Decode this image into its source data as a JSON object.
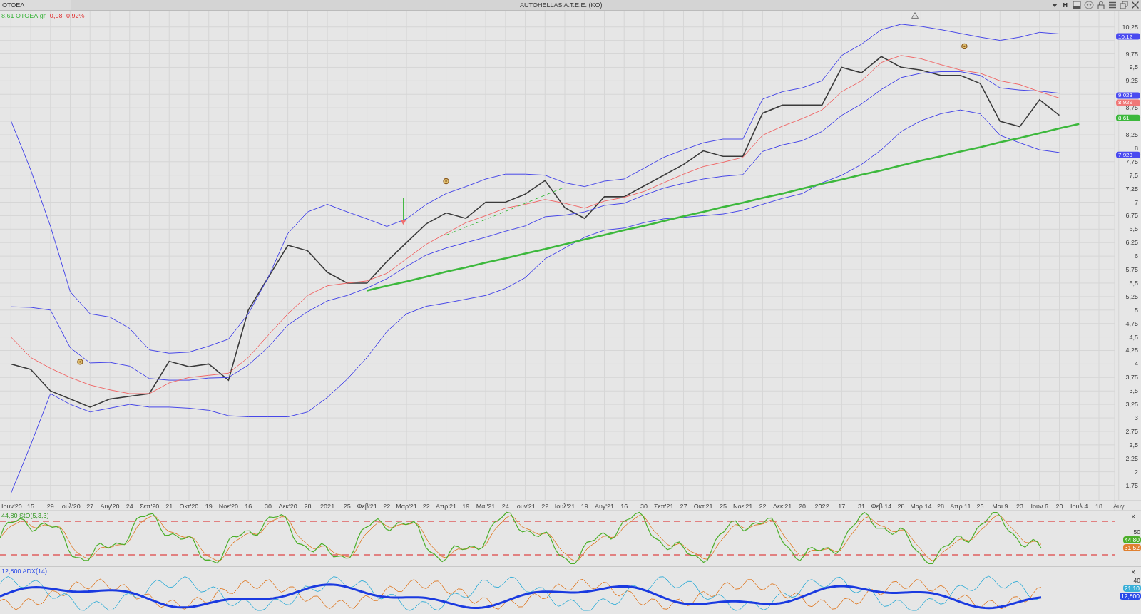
{
  "window": {
    "symbol_tab": "ΟΤΟΕΛ",
    "title": "AUTOHELLAS A.T.E.E. (KO)",
    "toolbar_letter": "H"
  },
  "quote": {
    "last": "8,61 ΟΤΟΕΛ.gr",
    "change": "-0,08 -0,92%"
  },
  "price_chart": {
    "chart_data": {
      "type": "line",
      "grid": true,
      "categories": [
        "Ιουν'20",
        "15",
        "29",
        "Ιουλ'20",
        "27",
        "Αυγ'20",
        "24",
        "Σεπ'20",
        "21",
        "Οκτ'20",
        "19",
        "Νοε'20",
        "16",
        "30",
        "Δεκ'20",
        "28",
        "2021",
        "25",
        "Φεβ'21",
        "22",
        "Μαρ'21",
        "22",
        "Απρ'21",
        "19",
        "Μαι'21",
        "24",
        "Ιουν'21",
        "22",
        "Ιουλ'21",
        "19",
        "Αυγ'21",
        "16",
        "30",
        "Σεπ'21",
        "27",
        "Οκτ'21",
        "25",
        "Νοε'21",
        "22",
        "Δεκ'21",
        "20",
        "2022",
        "17",
        "31",
        "Φεβ 14",
        "28",
        "Μαρ 14",
        "28",
        "Απρ 11",
        "26",
        "Μαι 9",
        "23",
        "Ιουν 6",
        "20",
        "Ιουλ 4",
        "18",
        "Αυγ"
      ],
      "ylim": [
        1.48,
        10.55
      ],
      "yticks": [
        {
          "value": 10.25,
          "label": "10,25"
        },
        {
          "value": 9.75,
          "label": "9,75"
        },
        {
          "value": 9.5,
          "label": "9,5"
        },
        {
          "value": 9.25,
          "label": "9,25"
        },
        {
          "value": 8.75,
          "label": "8,75"
        },
        {
          "value": 8.25,
          "label": "8,25"
        },
        {
          "value": 8,
          "label": "8"
        },
        {
          "value": 7.75,
          "label": "7,75"
        },
        {
          "value": 7.5,
          "label": "7,5"
        },
        {
          "value": 7.25,
          "label": "7,25"
        },
        {
          "value": 7,
          "label": "7"
        },
        {
          "value": 6.75,
          "label": "6,75"
        },
        {
          "value": 6.5,
          "label": "6,5"
        },
        {
          "value": 6.25,
          "label": "6,25"
        },
        {
          "value": 6,
          "label": "6"
        },
        {
          "value": 5.75,
          "label": "5,75"
        },
        {
          "value": 5.5,
          "label": "5,5"
        },
        {
          "value": 5.25,
          "label": "5,25"
        },
        {
          "value": 5,
          "label": "5"
        },
        {
          "value": 4.75,
          "label": "4,75"
        },
        {
          "value": 4.5,
          "label": "4,5"
        },
        {
          "value": 4.25,
          "label": "4,25"
        },
        {
          "value": 4,
          "label": "4"
        },
        {
          "value": 3.75,
          "label": "3,75"
        },
        {
          "value": 3.5,
          "label": "3,5"
        },
        {
          "value": 3.25,
          "label": "3,25"
        },
        {
          "value": 3,
          "label": "3"
        },
        {
          "value": 2.75,
          "label": "2,75"
        },
        {
          "value": 2.5,
          "label": "2,5"
        },
        {
          "value": 2.25,
          "label": "2,25"
        },
        {
          "value": 2,
          "label": "2"
        },
        {
          "value": 1.75,
          "label": "1,75"
        }
      ],
      "series": [
        {
          "color": "#3a3a3a",
          "values": [
            4.0,
            3.9,
            3.5,
            3.35,
            3.2,
            3.35,
            3.4,
            3.45,
            4.05,
            3.95,
            4.0,
            3.7,
            5.0,
            5.6,
            6.2,
            6.1,
            5.7,
            5.5,
            5.5,
            5.9,
            6.25,
            6.6,
            6.8,
            6.7,
            7.0,
            7.0,
            7.15,
            7.4,
            6.9,
            6.7,
            7.1,
            7.1,
            7.3,
            7.5,
            7.7,
            7.95,
            7.85,
            7.85,
            8.65,
            8.8,
            8.8,
            8.8,
            9.5,
            9.4,
            9.7,
            9.5,
            9.45,
            9.35,
            9.35,
            9.2,
            8.5,
            8.4,
            8.9,
            8.61,
            null,
            null,
            null
          ]
        },
        {
          "color": "#4848e8",
          "values": [
            8.51,
            7.6,
            6.55,
            5.34,
            4.93,
            4.87,
            4.66,
            4.26,
            4.2,
            4.22,
            4.33,
            4.46,
            4.93,
            5.6,
            6.42,
            6.82,
            6.96,
            6.82,
            6.69,
            6.55,
            6.69,
            6.96,
            7.16,
            7.29,
            7.43,
            7.52,
            7.52,
            7.5,
            7.36,
            7.29,
            7.39,
            7.43,
            7.63,
            7.83,
            7.97,
            8.1,
            8.17,
            8.17,
            8.91,
            9.05,
            9.12,
            9.25,
            9.72,
            9.93,
            10.2,
            10.3,
            10.26,
            10.2,
            10.13,
            10.06,
            10.0,
            10.06,
            10.15,
            10.12,
            null,
            null,
            null
          ]
        },
        {
          "color": "#4848e8",
          "values": [
            5.06,
            5.05,
            5.0,
            4.3,
            4.02,
            4.03,
            3.96,
            3.73,
            3.7,
            3.7,
            3.74,
            3.75,
            3.98,
            4.31,
            4.72,
            4.97,
            5.17,
            5.27,
            5.41,
            5.58,
            5.81,
            6.02,
            6.15,
            6.25,
            6.35,
            6.46,
            6.56,
            6.73,
            6.76,
            6.82,
            6.94,
            6.98,
            7.13,
            7.26,
            7.35,
            7.43,
            7.48,
            7.51,
            7.94,
            8.06,
            8.14,
            8.31,
            8.61,
            8.82,
            9.09,
            9.31,
            9.39,
            9.42,
            9.42,
            9.35,
            9.12,
            9.08,
            9.06,
            9.02,
            null,
            null,
            null
          ]
        },
        {
          "color": "#f06a6a",
          "values": [
            4.5,
            4.12,
            3.92,
            3.75,
            3.61,
            3.52,
            3.45,
            3.45,
            3.65,
            3.75,
            3.79,
            3.83,
            4.12,
            4.53,
            4.93,
            5.27,
            5.45,
            5.5,
            5.54,
            5.68,
            5.95,
            6.22,
            6.42,
            6.62,
            6.75,
            6.89,
            6.96,
            7.05,
            6.98,
            6.89,
            7.02,
            7.09,
            7.2,
            7.36,
            7.52,
            7.66,
            7.74,
            7.83,
            8.24,
            8.41,
            8.55,
            8.71,
            9.05,
            9.25,
            9.59,
            9.72,
            9.66,
            9.55,
            9.45,
            9.39,
            9.25,
            9.18,
            9.05,
            8.93,
            null,
            null,
            null
          ]
        },
        {
          "color": "#4848e8",
          "values": [
            1.6,
            2.5,
            3.45,
            3.25,
            3.11,
            3.18,
            3.25,
            3.2,
            3.2,
            3.18,
            3.14,
            3.04,
            3.02,
            3.02,
            3.02,
            3.11,
            3.38,
            3.72,
            4.12,
            4.6,
            4.93,
            5.07,
            5.13,
            5.2,
            5.27,
            5.4,
            5.6,
            5.95,
            6.15,
            6.35,
            6.48,
            6.52,
            6.62,
            6.69,
            6.72,
            6.75,
            6.78,
            6.85,
            6.96,
            7.07,
            7.16,
            7.36,
            7.5,
            7.7,
            7.97,
            8.31,
            8.51,
            8.64,
            8.71,
            8.64,
            8.24,
            8.1,
            7.97,
            7.92,
            null,
            null,
            null
          ]
        },
        {
          "color": "#3cb83c",
          "values": [
            null,
            null,
            null,
            null,
            null,
            null,
            null,
            null,
            null,
            null,
            null,
            null,
            null,
            null,
            null,
            null,
            null,
            null,
            5.36,
            5.45,
            5.53,
            5.62,
            5.71,
            5.79,
            5.88,
            5.96,
            6.05,
            6.13,
            6.22,
            6.31,
            6.39,
            6.48,
            6.56,
            6.65,
            6.74,
            6.82,
            6.91,
            6.99,
            7.08,
            7.16,
            7.25,
            7.34,
            7.42,
            7.51,
            7.59,
            7.68,
            7.77,
            7.85,
            7.94,
            8.02,
            8.11,
            8.19,
            8.28,
            8.37,
            8.45,
            null,
            null
          ]
        },
        {
          "color": "#3cb83c",
          "line_style": "dashed",
          "values": [
            null,
            null,
            null,
            null,
            null,
            null,
            null,
            null,
            null,
            null,
            null,
            null,
            null,
            null,
            null,
            null,
            null,
            null,
            null,
            null,
            null,
            null,
            6.39,
            6.54,
            6.68,
            6.83,
            6.98,
            7.13,
            7.28,
            null,
            null,
            null,
            null,
            null,
            null,
            null,
            null,
            null,
            null,
            null,
            null,
            null,
            null,
            null,
            null,
            null,
            null,
            null,
            null,
            null,
            null,
            null,
            null,
            null,
            null,
            null,
            null
          ]
        }
      ]
    },
    "price_tags": [
      {
        "text": "10,12",
        "color": "#4a4af0"
      },
      {
        "text": "9,023",
        "color": "#4a4af0"
      },
      {
        "text": "8,929",
        "color": "#f07878"
      },
      {
        "text": "8,61",
        "color": "#3cb83c"
      },
      {
        "text": "7,923",
        "color": "#4a4af0"
      }
    ]
  },
  "stochastic": {
    "legend": "44,80 StO(5,3,3)",
    "tick": "50",
    "close": "×",
    "tags": [
      {
        "text": "44,80",
        "color": "#4caf2a"
      },
      {
        "text": "31,52",
        "color": "#e08030"
      }
    ]
  },
  "adx": {
    "legend": "12,800 ADX(14)",
    "tick": "40",
    "close": "×",
    "tags": [
      {
        "text": "21,10",
        "color": "#3ab0d8"
      },
      {
        "text": "12,800",
        "color": "#2a4ae8"
      }
    ]
  }
}
